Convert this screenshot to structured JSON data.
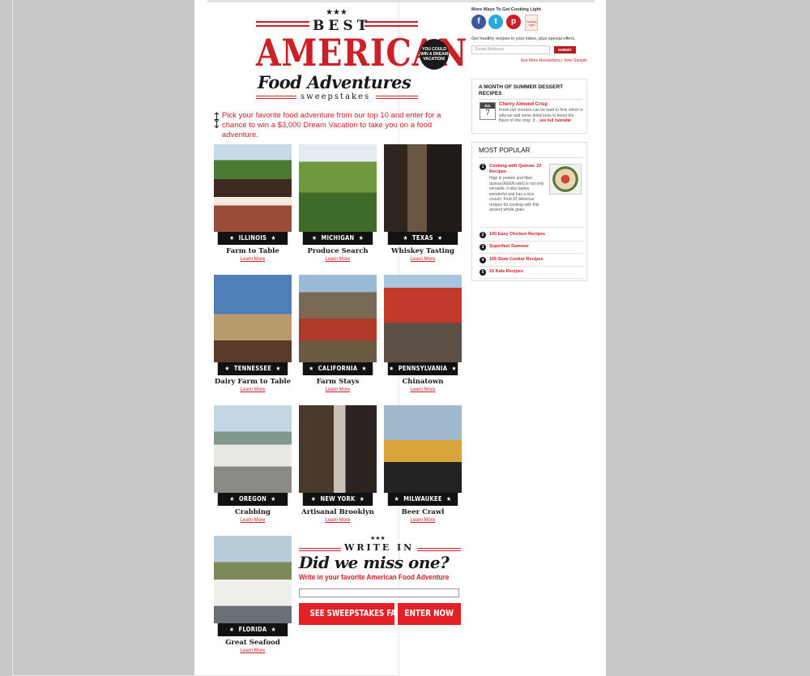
{
  "hero": {
    "stars": "★★★",
    "best": "BEST",
    "american": "AMERICAN",
    "food_adventures": "Food Adventures",
    "sweepstakes": "sweepstakes",
    "badge": "YOU COULD WIN A DREAM VACATION!"
  },
  "intro": {
    "text": "Pick your favorite food adventure from our top 10 and enter for a chance to win a $3,000 Dream Vacation to take you on a food adventure."
  },
  "cards": [
    {
      "state": "ILLINOIS",
      "title": "Farm to Table",
      "link": "Learn More"
    },
    {
      "state": "MICHIGAN",
      "title": "Produce Search",
      "link": "Learn More"
    },
    {
      "state": "TEXAS",
      "title": "Whiskey Tasting",
      "link": "Learn More"
    },
    {
      "state": "TENNESSEE",
      "title": "Dairy Farm to Table",
      "link": "Learn More"
    },
    {
      "state": "CALIFORNIA",
      "title": "Farm Stays",
      "link": "Learn More"
    },
    {
      "state": "PENNSYLVANIA",
      "title": "Chinatown",
      "link": "Learn More"
    },
    {
      "state": "OREGON",
      "title": "Crabbing",
      "link": "Learn More"
    },
    {
      "state": "NEW YORK",
      "title": "Artisanal Brooklyn",
      "link": "Learn More"
    },
    {
      "state": "MILWAUKEE",
      "title": "Beer Crawl",
      "link": "Learn More"
    },
    {
      "state": "FLORIDA",
      "title": "Great Seafood",
      "link": "Learn More"
    }
  ],
  "write_in": {
    "stars": "★★★",
    "title": "WRITE IN",
    "headline": "Did we miss one?",
    "subtitle": "Write in your favorite American Food Adventure",
    "facts_button": "SEE SWEEPSTAKES FACTS",
    "enter_button": "ENTER NOW"
  },
  "sidebar": {
    "more_ways": "More Ways To Get Cooking Light",
    "magazine": "Cooking Light",
    "newsletter_text": "Get healthy recipes in your inbox, plus special offers.",
    "email_placeholder": "Email Address",
    "submit": "SUBMIT",
    "see_more": "See More Newsletters",
    "view_sample": "View Sample",
    "dessert": {
      "heading": "A MONTH OF SUMMER DESSERT RECIPES",
      "month": "JUL",
      "day": "7",
      "title": "Cherry Almond Crisp",
      "text": "Fresh tart cherries can be hard to find, which is why we add some dried ones to boost the flavor of this crisp. If...",
      "link": "see full calendar"
    },
    "popular": {
      "heading": "MOST POPULAR",
      "items": [
        {
          "num": "1",
          "title": "Cooking with Quinoa: 22 Recipes",
          "text": "High in protein and fiber, quinoa [KEEN-wah] is not only versatile, it also tastes wonderful and has a nice crunch. Find 22 delicious recipes for cooking with this ancient whole grain."
        },
        {
          "num": "2",
          "title": "100 Easy Chicken Recipes"
        },
        {
          "num": "3",
          "title": "Superfast Summer"
        },
        {
          "num": "4",
          "title": "105 Slow Cooker Recipes"
        },
        {
          "num": "5",
          "title": "15 Kale Recipes"
        }
      ]
    }
  },
  "colors": {
    "accent": "#cc1f26",
    "button": "#e32228",
    "background": "#c8c8c8"
  }
}
